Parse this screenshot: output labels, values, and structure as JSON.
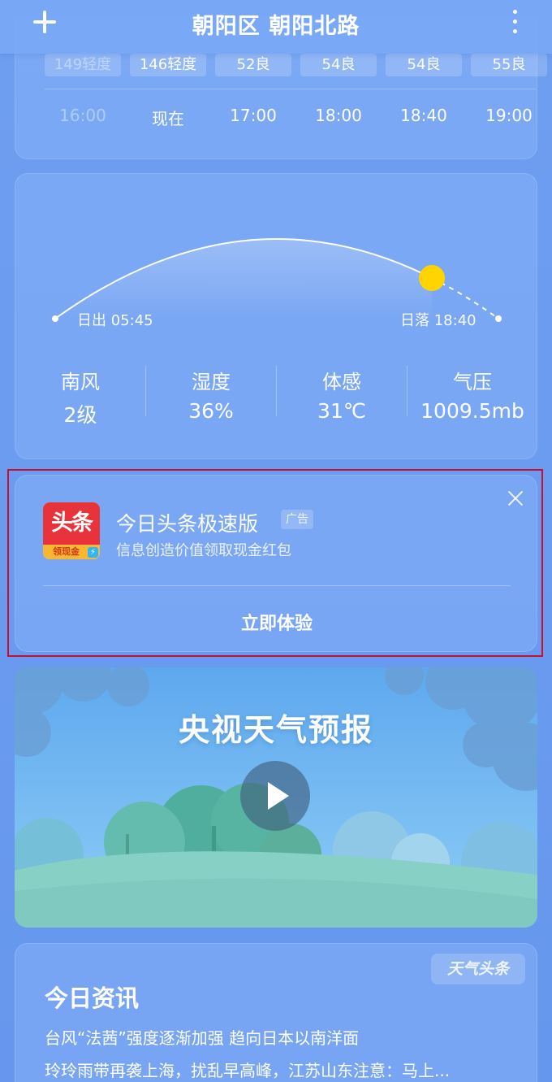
{
  "header": {
    "location": "朝阳区  朝阳北路",
    "add_icon": "plus-icon",
    "more_icon": "more-vertical-icon"
  },
  "aqi_forecast": {
    "items": [
      {
        "aqi": "149轻度",
        "time": "16:00",
        "past": true
      },
      {
        "aqi": "146轻度",
        "time": "现在",
        "past": false
      },
      {
        "aqi": "52良",
        "time": "17:00",
        "past": false
      },
      {
        "aqi": "54良",
        "time": "18:00",
        "past": false
      },
      {
        "aqi": "54良",
        "time": "18:40",
        "past": false
      },
      {
        "aqi": "55良",
        "time": "19:00",
        "past": false
      }
    ]
  },
  "sun": {
    "sunrise_label": "日出 05:45",
    "sunset_label": "日落 18:40",
    "day_progress": 0.85,
    "sun_color": "#ffd400"
  },
  "stats": [
    {
      "label": "南风",
      "value": "2级"
    },
    {
      "label": "湿度",
      "value": "36%"
    },
    {
      "label": "体感",
      "value": "31℃"
    },
    {
      "label": "气压",
      "value": "1009.5mb"
    }
  ],
  "ad": {
    "logo_text": "头条",
    "logo_sub": "领现金",
    "title": "今日头条极速版",
    "tag": "广告",
    "subtitle": "信息创造价值领取现金红包",
    "cta": "立即体验",
    "close_icon": "close-icon",
    "highlight_color": "#c8102e"
  },
  "video": {
    "title": "央视天气预报",
    "play_icon": "play-icon"
  },
  "news": {
    "badge": "天气头条",
    "title": "今日资讯",
    "items": [
      "台风“法茜”强度逐渐加强 趋向日本以南洋面",
      "玲玲雨带再袭上海，扰乱早高峰，江苏山东注意：马上..."
    ]
  }
}
